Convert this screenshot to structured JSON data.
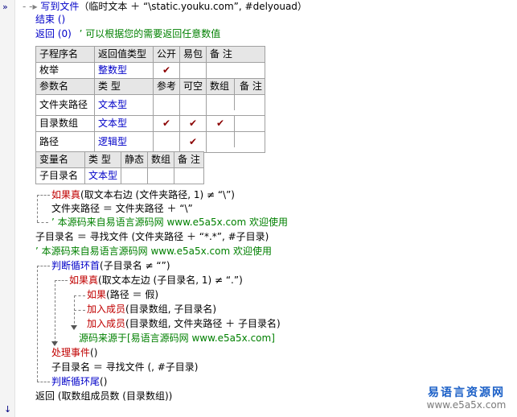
{
  "gutter": {
    "top_arrow": "»",
    "bottom_arrow": "↓"
  },
  "lines": {
    "l0_fn": "写到文件",
    "l0_rest": "（临时文本 ＋ “\\static.youku.com”, #delyouad）",
    "l1_end": "结束 ()",
    "l2_return": "返回 (0)",
    "l2_comment": "’ 可以根据您的需要返回任意数值"
  },
  "sub_table": {
    "headers": [
      "子程序名",
      "返回值类型",
      "公开",
      "易包",
      "备 注"
    ],
    "row": [
      "枚举",
      "整数型",
      "✔",
      "",
      ""
    ]
  },
  "param_table": {
    "headers": [
      "参数名",
      "类 型",
      "参考",
      "可空",
      "数组",
      "备 注"
    ],
    "rows": [
      [
        "文件夹路径",
        "文本型",
        "",
        "",
        "",
        ""
      ],
      [
        "目录数组",
        "文本型",
        "✔",
        "✔",
        "✔",
        ""
      ],
      [
        "路径",
        "逻辑型",
        "",
        "✔",
        "",
        ""
      ]
    ]
  },
  "var_table": {
    "headers": [
      "变量名",
      "类 型",
      "静态",
      "数组",
      "备 注"
    ],
    "row": [
      "子目录名",
      "文本型",
      "",
      "",
      ""
    ]
  },
  "code": {
    "c1_kw": "如果真",
    "c1_cond": "(取文本右边 (文件夹路径, 1) ≠ “\\”)",
    "c2": "文件夹路径 ＝ 文件夹路径 ＋ “\\”",
    "c3": "’ 本源码来自易语言源码网 www.e5a5x.com  欢迎使用",
    "c4": "子目录名 ＝ 寻找文件 (文件夹路径 ＋ “*.*”, #子目录)",
    "c5": "’ 本源码来自易语言源码网 www.e5a5x.com  欢迎使用",
    "c6_kw": "判断循环首",
    "c6_rest": "(子目录名 ≠ “”)",
    "c7_kw": "如果真",
    "c7_cond": "(取文本左边 (子目录名, 1) ≠ “.”)",
    "c8_kw": "如果",
    "c8_rest": "(路径 ＝ 假)",
    "c9_kw": "加入成员",
    "c9_rest": "(目录数组, 子目录名)",
    "c10_kw": "加入成员",
    "c10_rest": "(目录数组, 文件夹路径 ＋ 子目录名)",
    "c11": "源码来源于[易语言源码网 www.e5a5x.com]",
    "c12_kw": "处理事件",
    "c12_rest": "()",
    "c13": "子目录名 ＝ 寻找文件 (, #子目录)",
    "c14_kw": "判断循环尾",
    "c14_rest": "()",
    "c15": "返回 (取数组成员数 (目录数组))"
  },
  "watermark": {
    "line1": "易语言资源网",
    "line2": "www.e5a5x.com"
  },
  "colors": {
    "keyword": "#0000c8",
    "flow": "#c00000",
    "comment": "#008000",
    "check": "#8b0000",
    "watermark": "#1a5fc7"
  }
}
